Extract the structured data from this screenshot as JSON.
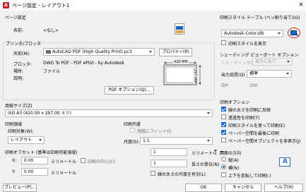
{
  "window": {
    "title": "ページ設定 - レイアウト1",
    "close": "×"
  },
  "page_setup": {
    "group": "ページ設定",
    "name_label": "名前:",
    "name_value": "<なし>"
  },
  "printer": {
    "group": "プリンタ/プロッタ",
    "name_label": "名前(M):",
    "name_value": "AutoCAD PDF (High Quality Print).pc3",
    "properties_button": "プロパティ(R)",
    "plotter_label": "プロッタ:",
    "plotter_value": "DWG To PDF - PDF ePlot - by Autodesk",
    "location_label": "場所:",
    "location_value": "ファイル",
    "description_label": "説明:",
    "pdf_options_button": "PDF オプション(Q)...",
    "preview_width": "420 MM",
    "preview_height": "297 MM"
  },
  "paper_size": {
    "group": "用紙サイズ(Z)",
    "value": "ISO A3 (420.00 x 297.00 ミリ)"
  },
  "plot_area": {
    "group": "印刷領域",
    "target_label": "印刷対象(W):",
    "target_value": "レイアウト"
  },
  "plot_offset": {
    "group": "印刷オフセット (基準は印刷可能領域)",
    "x_label": "X:",
    "x_value": "0.00",
    "x_unit": "ミリメートル",
    "center_label": "印刷の中心(C)",
    "y_label": "Y:",
    "y_value": "0.00",
    "y_unit": "ミリメートル"
  },
  "plot_scale": {
    "group": "印刷尺度",
    "fit_label": "用紙にフィット(I)",
    "scale_label": "尺度(S):",
    "scale_value": "1:1",
    "value1": "1",
    "unit1": "ミリメートル",
    "equals": "=",
    "value2": "1",
    "unit2": "長さの単位(N)",
    "lineweight_label": "線の太さの尺度を有効(L)"
  },
  "plot_style_table": {
    "group": "印刷スタイル テーブル (ペン割り当て)(G)",
    "value": "Autodesk-Color.stb",
    "display_label": "印刷スタイルを表示"
  },
  "shaded_viewport": {
    "group": "シェーディング ビューポート オプション",
    "shade_label": "シェーディング(D)",
    "shade_value": "表示どおり",
    "quality_label": "出力品質(Q)",
    "quality_value": "標準",
    "dpi_label": "DPI",
    "dpi_value": "100"
  },
  "plot_options": {
    "group": "印刷オプション",
    "opt1": "線の太さを印刷に反映",
    "opt2": "透過性を印刷(T)",
    "opt3": "印刷スタイルを使って印刷(E)",
    "opt4": "ペーパー空間を最後に印刷",
    "opt5": "ペーパー空間オブジェクトを非表示(J)"
  },
  "orientation": {
    "group": "図面の方向",
    "portrait": "縦(A)",
    "landscape": "横(N)",
    "upside_down": "上下を反転して印刷(-)"
  },
  "footer": {
    "preview": "プレビュー(P)...",
    "ok": "OK",
    "cancel": "キャンセル",
    "help": "ヘルプ(H)"
  }
}
